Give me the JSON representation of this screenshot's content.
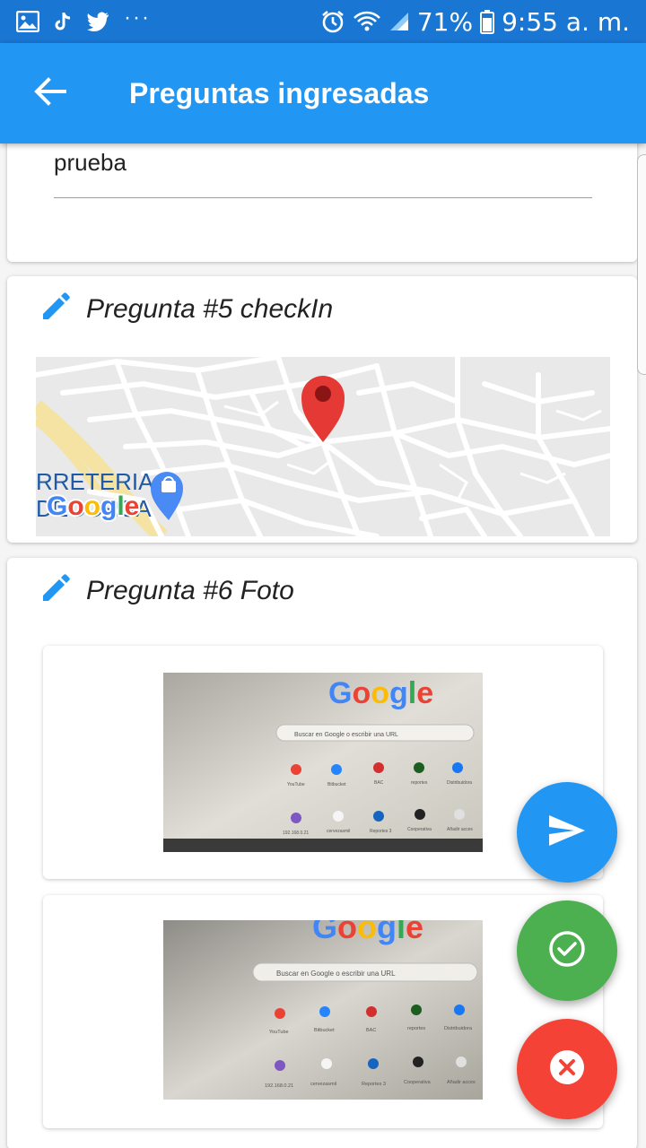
{
  "status_bar": {
    "battery": "71%",
    "time": "9:55 a. m.",
    "more": "···",
    "icons": [
      "image-icon",
      "tiktok-icon",
      "twitter-icon",
      "alarm-icon",
      "wifi-icon",
      "signal-icon",
      "battery-icon"
    ]
  },
  "app_bar": {
    "title": "Preguntas ingresadas",
    "back_icon": "arrow-back-icon"
  },
  "previous_answer": {
    "value": "prueba"
  },
  "questions": [
    {
      "label": "Pregunta #5 checkIn",
      "type": "map",
      "icon": "edit-pencil-icon"
    },
    {
      "label": "Pregunta #6 Foto",
      "type": "photos",
      "icon": "edit-pencil-icon"
    }
  ],
  "map": {
    "poi_label": "RRETERIA\nDECORSA",
    "logo": "Google",
    "pin_color": "#e53935"
  },
  "photos": [
    {
      "logo": "Google",
      "search_placeholder": "Buscar en Google o escribir una URL",
      "shortcuts_row1": [
        "YouTube",
        "Bitbucket",
        "BAC",
        "reportes",
        "Distribuidora"
      ],
      "shortcuts_row2": [
        "192.168.0.21",
        "cervezasmil",
        "Reportes 3",
        "Cooperativa",
        "Añadir acces"
      ]
    },
    {
      "logo": "Google",
      "search_placeholder": "Buscar en Google o escribir una URL",
      "shortcuts_row1": [
        "YouTube",
        "Bitbucket",
        "BAC",
        "reportes",
        "Distribuidora"
      ],
      "shortcuts_row2": [
        "192.168.0.21",
        "cervezasmil",
        "Reportes 3",
        "Cooperativa",
        "Añadir acces"
      ]
    }
  ],
  "actions": {
    "send_icon": "send-icon",
    "confirm_icon": "check-circle-icon",
    "cancel_icon": "cancel-circle-icon"
  },
  "colors": {
    "status_bar": "#1976d2",
    "app_bar": "#2196f3",
    "send": "#2196f3",
    "confirm": "#4caf50",
    "cancel": "#f44336"
  }
}
